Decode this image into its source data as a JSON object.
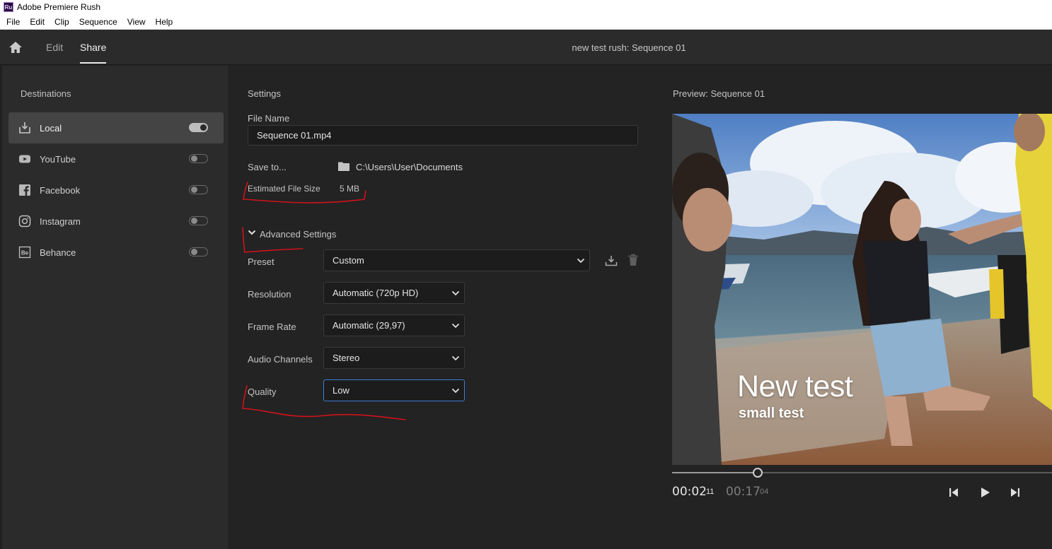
{
  "app": {
    "logo": "Ru",
    "title": "Adobe Premiere Rush"
  },
  "menu": [
    "File",
    "Edit",
    "Clip",
    "Sequence",
    "View",
    "Help"
  ],
  "topnav": {
    "home_icon": "home-icon",
    "tabs": [
      "Edit",
      "Share"
    ],
    "active_tab": "Share",
    "sequence_title": "new test rush: Sequence 01"
  },
  "sidebar": {
    "heading": "Destinations",
    "items": [
      {
        "label": "Local",
        "icon": "download-icon",
        "enabled": true
      },
      {
        "label": "YouTube",
        "icon": "youtube-icon",
        "enabled": false
      },
      {
        "label": "Facebook",
        "icon": "facebook-icon",
        "enabled": false
      },
      {
        "label": "Instagram",
        "icon": "instagram-icon",
        "enabled": false
      },
      {
        "label": "Behance",
        "icon": "behance-icon",
        "enabled": false
      }
    ]
  },
  "settings": {
    "heading": "Settings",
    "file_name_label": "File Name",
    "file_name_value": "Sequence 01.mp4",
    "save_to_label": "Save to...",
    "save_to_path": "C:\\Users\\User\\Documents",
    "size_label": "Estimated File Size",
    "size_value": "5 MB",
    "advanced_label": "Advanced Settings",
    "preset_label": "Preset",
    "preset_value": "Custom",
    "resolution_label": "Resolution",
    "resolution_value": "Automatic (720p HD)",
    "framerate_label": "Frame Rate",
    "framerate_value": "Automatic (29,97)",
    "audio_label": "Audio Channels",
    "audio_value": "Stereo",
    "quality_label": "Quality",
    "quality_value": "Low"
  },
  "preview": {
    "title": "Preview: Sequence 01",
    "overlay_title": "New test",
    "overlay_subtitle": "small test",
    "current_time": "00:02",
    "current_frames": "11",
    "total_time": "00:17",
    "total_frames": "04",
    "playhead_progress": 0.14
  },
  "colors": {
    "annotation": "#d0121b",
    "accent": "#3e7ad6",
    "panel": "#2b2b2b",
    "background": "#232323"
  }
}
